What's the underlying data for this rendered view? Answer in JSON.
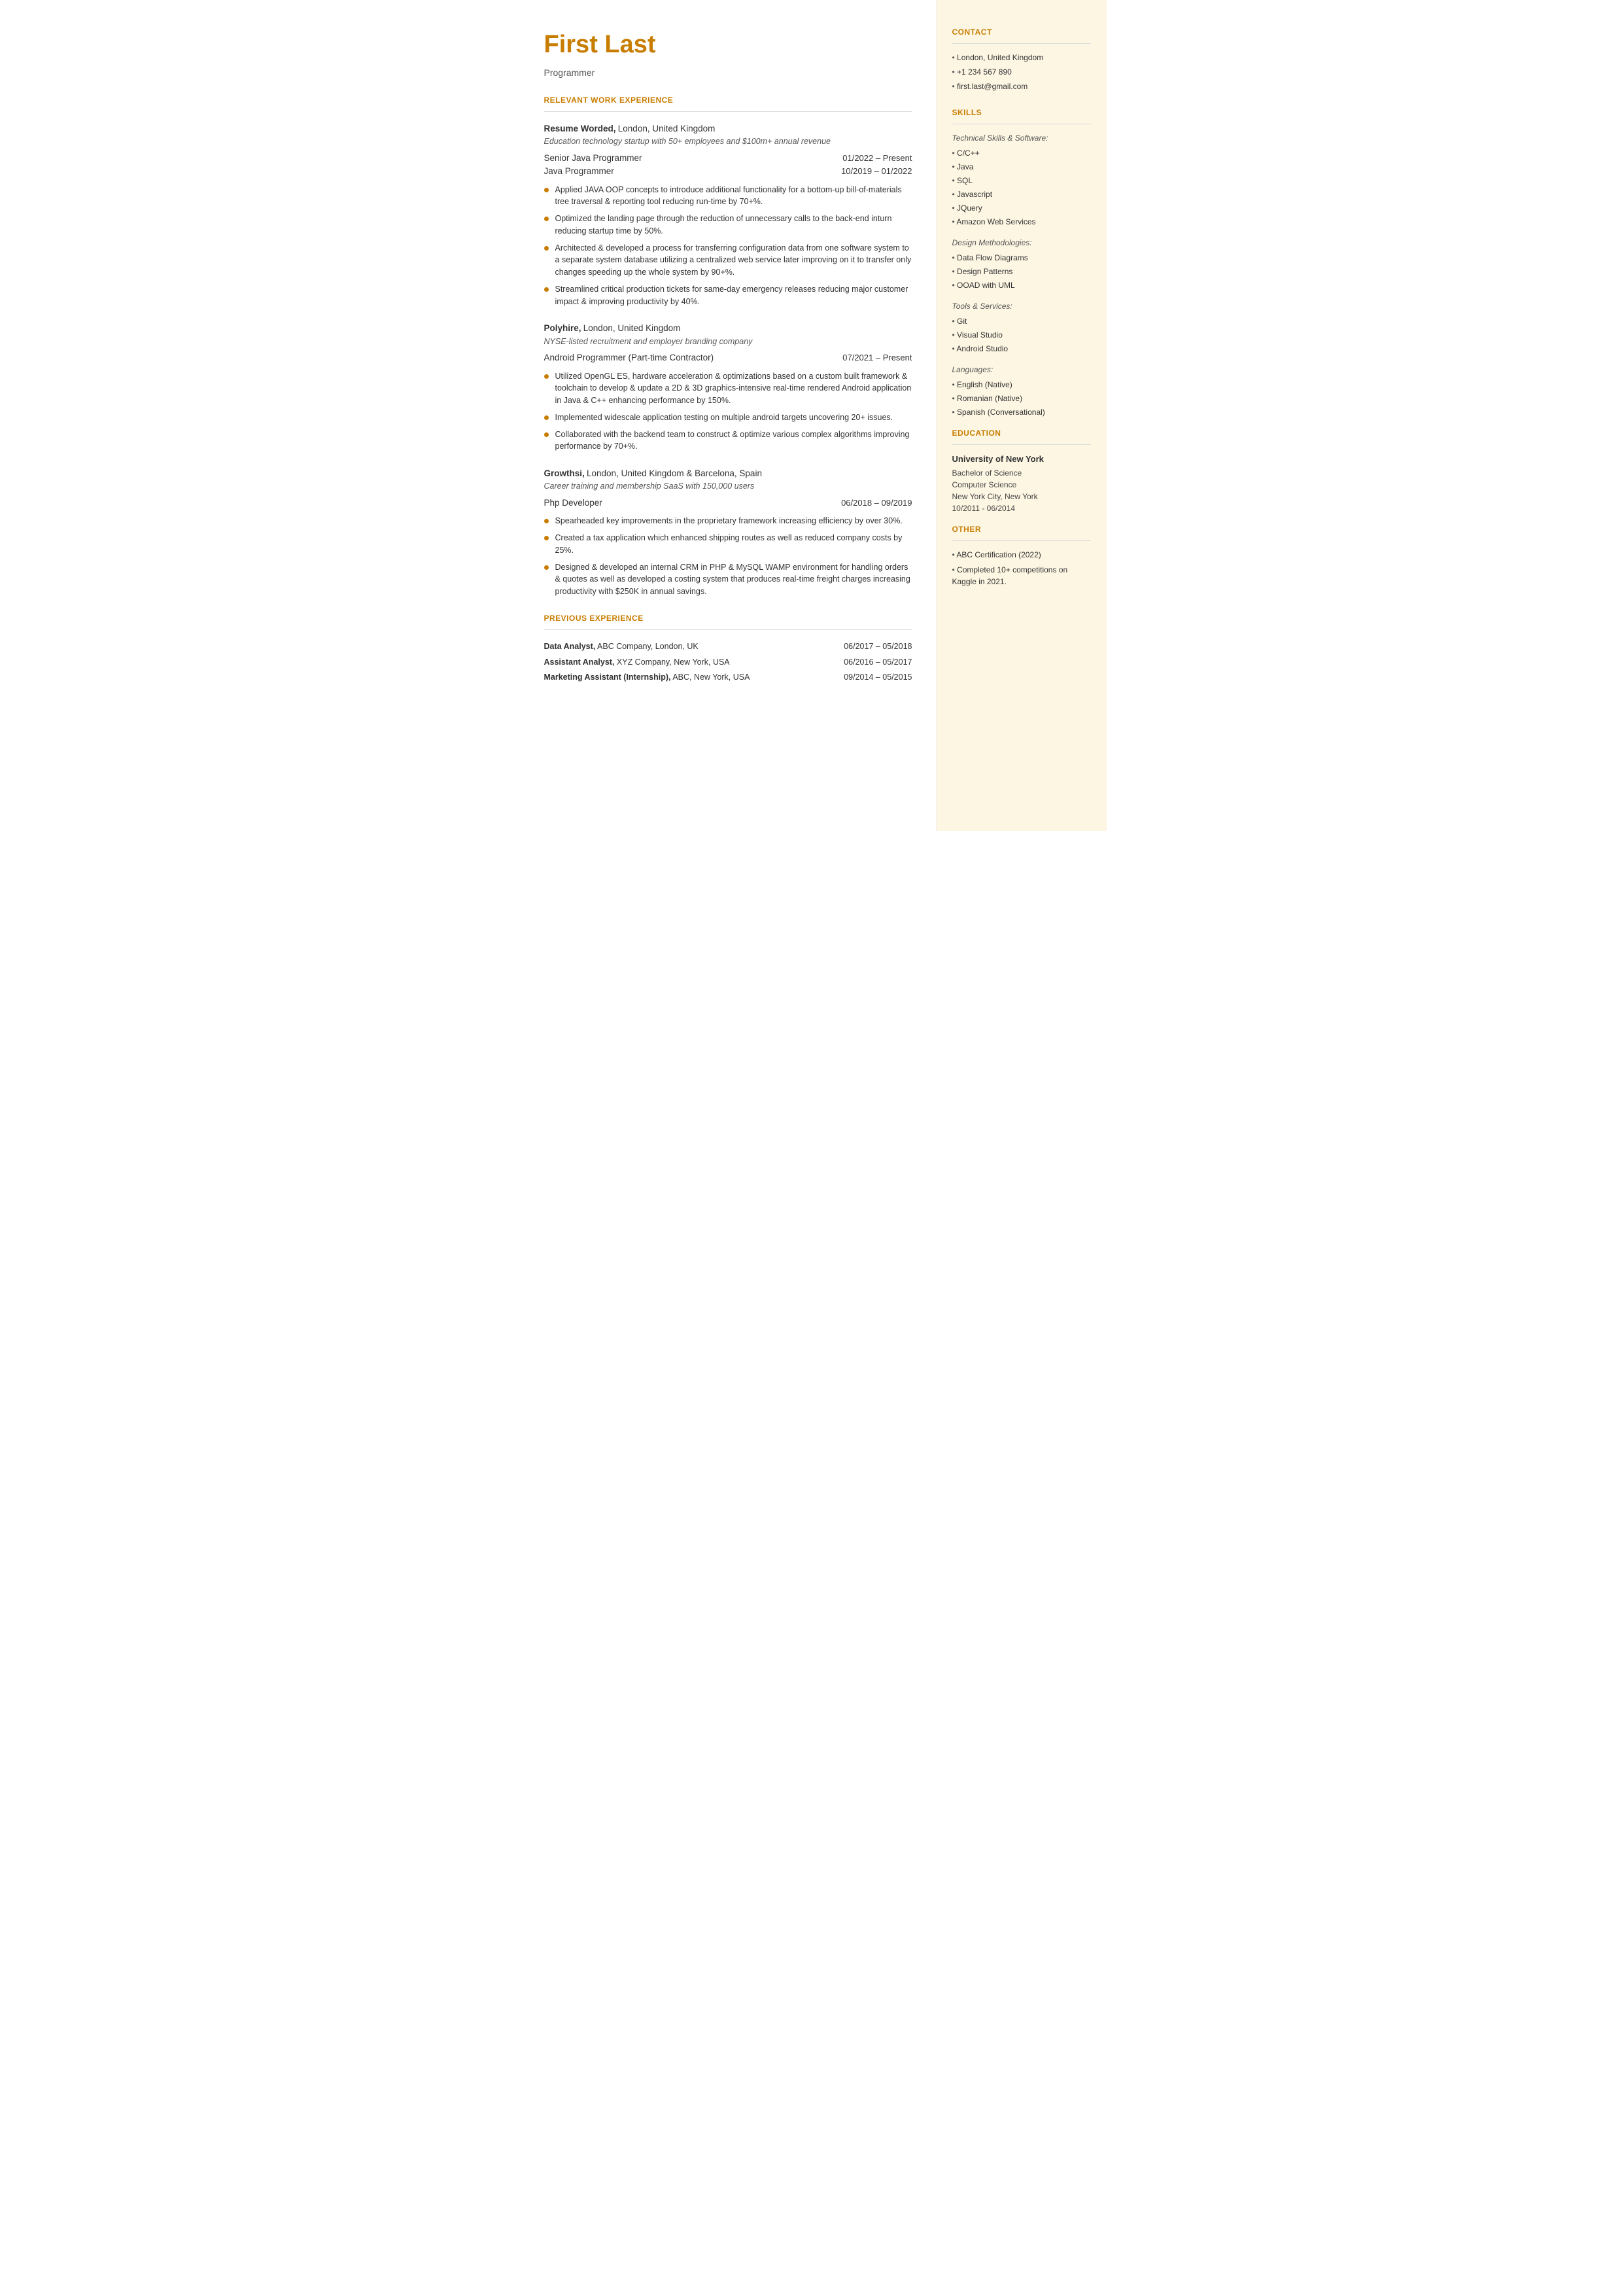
{
  "header": {
    "name": "First Last",
    "title": "Programmer"
  },
  "sections": {
    "relevant_work_title": "RELEVANT WORK EXPERIENCE",
    "previous_work_title": "PREVIOUS EXPERIENCE"
  },
  "jobs": [
    {
      "company": "Resume Worded,",
      "company_rest": " London, United Kingdom",
      "description": "Education technology startup with 50+ employees and $100m+ annual revenue",
      "positions": [
        {
          "title": "Senior Java Programmer",
          "dates": "01/2022 – Present"
        },
        {
          "title": "Java Programmer",
          "dates": "10/2019 – 01/2022"
        }
      ],
      "bullets": [
        "Applied JAVA OOP concepts to introduce additional functionality for a bottom-up bill-of-materials tree traversal & reporting tool reducing run-time by 70+%.",
        "Optimized the landing page through the reduction of unnecessary calls to the back-end inturn reducing startup time by 50%.",
        "Architected & developed a process for transferring configuration data from one software system to a separate system database utilizing a centralized web service later improving on it to transfer only changes speeding up the whole system by 90+%.",
        "Streamlined critical production tickets for same-day emergency releases reducing major customer impact & improving productivity by 40%."
      ]
    },
    {
      "company": "Polyhire,",
      "company_rest": " London, United Kingdom",
      "description": "NYSE-listed recruitment and employer branding company",
      "positions": [
        {
          "title": "Android Programmer (Part-time Contractor)",
          "dates": "07/2021 – Present"
        }
      ],
      "bullets": [
        "Utilized OpenGL ES, hardware acceleration & optimizations based on a custom built framework & toolchain to develop & update a 2D & 3D graphics-intensive real-time rendered Android application in Java & C++ enhancing performance by 150%.",
        "Implemented widescale application testing on multiple android targets uncovering 20+ issues.",
        "Collaborated with the backend team to construct & optimize various complex algorithms improving performance by 70+%."
      ]
    },
    {
      "company": "Growthsi,",
      "company_rest": " London, United Kingdom & Barcelona, Spain",
      "description": "Career training and membership SaaS with 150,000 users",
      "positions": [
        {
          "title": "Php Developer",
          "dates": "06/2018 – 09/2019"
        }
      ],
      "bullets": [
        "Spearheaded key improvements in the proprietary framework increasing efficiency by over 30%.",
        "Created a tax application which enhanced shipping routes as well as reduced company costs by 25%.",
        "Designed & developed an internal CRM in PHP & MySQL WAMP environment for handling orders & quotes as well as developed a costing system that produces real-time freight charges increasing productivity with $250K in annual savings."
      ]
    }
  ],
  "previous_experience": [
    {
      "role_bold": "Data Analyst,",
      "role_rest": " ABC Company, London, UK",
      "dates": "06/2017 – 05/2018"
    },
    {
      "role_bold": "Assistant Analyst,",
      "role_rest": " XYZ Company, New York, USA",
      "dates": "06/2016 – 05/2017"
    },
    {
      "role_bold": "Marketing Assistant (Internship),",
      "role_rest": " ABC, New York, USA",
      "dates": "09/2014 – 05/2015"
    }
  ],
  "contact": {
    "title": "CONTACT",
    "items": [
      "London, United Kingdom",
      "+1 234 567 890",
      "first.last@gmail.com"
    ]
  },
  "skills": {
    "title": "SKILLS",
    "technical_label": "Technical Skills & Software:",
    "technical_items": [
      "C/C++",
      "Java",
      "SQL",
      "Javascript",
      "JQuery",
      "Amazon Web Services"
    ],
    "design_label": "Design Methodologies:",
    "design_items": [
      "Data Flow Diagrams",
      "Design Patterns",
      "OOAD with UML"
    ],
    "tools_label": "Tools & Services:",
    "tools_items": [
      "Git",
      "Visual Studio",
      "Android Studio"
    ],
    "languages_label": "Languages:",
    "languages_items": [
      "English (Native)",
      "Romanian (Native)",
      "Spanish (Conversational)"
    ]
  },
  "education": {
    "title": "EDUCATION",
    "school": "University of New York",
    "degree": "Bachelor of Science",
    "field": "Computer Science",
    "location": "New York City, New York",
    "dates": "10/2011 - 06/2014"
  },
  "other": {
    "title": "OTHER",
    "items": [
      "ABC Certification (2022)",
      "Completed 10+ competitions on Kaggle in 2021."
    ]
  }
}
